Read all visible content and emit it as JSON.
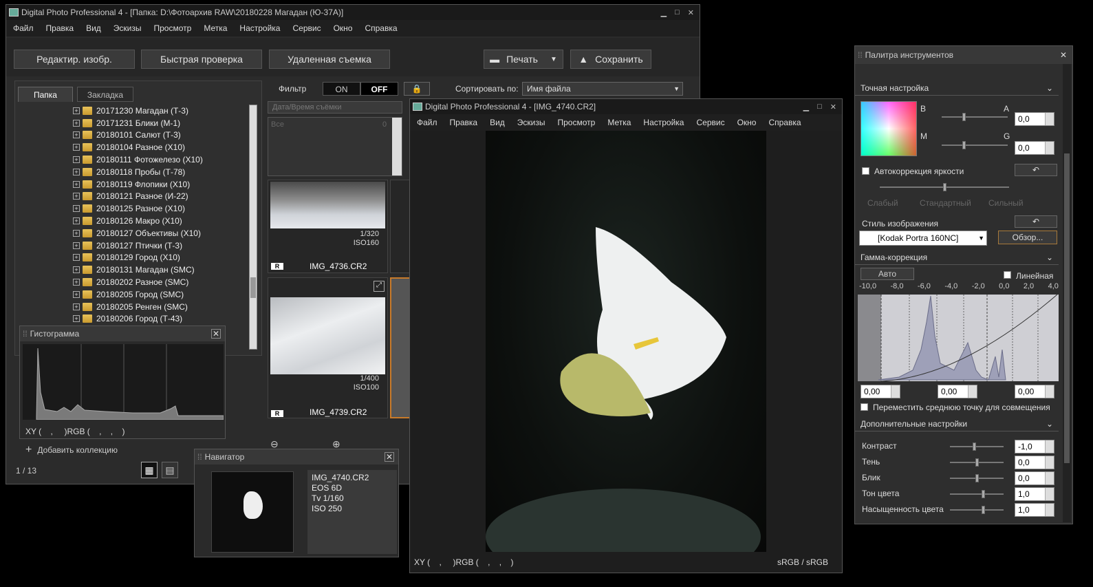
{
  "main": {
    "title": "Digital Photo Professional 4 - [Папка: D:\\Фотоархив RAW\\20180228 Магадан (Ю-37А)]",
    "menu": [
      "Файл",
      "Правка",
      "Вид",
      "Эскизы",
      "Просмотр",
      "Метка",
      "Настройка",
      "Сервис",
      "Окно",
      "Справка"
    ],
    "edit_btn": "Редактир. изобр.",
    "quick_btn": "Быстрая проверка",
    "remote_btn": "Удаленная съемка",
    "print_btn": "Печать",
    "save_btn": "Сохранить",
    "tab_folder": "Папка",
    "tab_bookmark": "Закладка",
    "folders": [
      "20171230 Магадан (Т-3)",
      "20171231 Блики (М-1)",
      "20180101 Салют (Т-3)",
      "20180104 Разное (Х10)",
      "20180111 Фотожелезо (Х10)",
      "20180118 Пробы (Т-78)",
      "20180119 Флопики (Х10)",
      "20180121 Разное (И-22)",
      "20180125 Разное (Х10)",
      "20180126 Макро (Х10)",
      "20180127 Объективы (Х10)",
      "20180127 Птички (Т-3)",
      "20180129 Город (Х10)",
      "20180131 Магадан (SMC)",
      "20180202 Разное (SMC)",
      "20180205 Город (SMC)",
      "20180205 Ренген (SMC)",
      "20180206 Город (Т-43)"
    ],
    "filter_label": "Фильтр",
    "on": "ON",
    "off": "OFF",
    "sort_label": "Сортировать по:",
    "sort_value": "Имя файла",
    "date_field": "Дата/Время съёмки",
    "all_label": "Все",
    "all_count": "0",
    "thumbs": [
      {
        "name": "IMG_4736.CR2",
        "shutter": "1/320",
        "iso": "ISO160"
      },
      {
        "name": "IMG_4739.CR2",
        "shutter": "1/400",
        "iso": "ISO100"
      }
    ],
    "raw_badge": "R",
    "add_collection": "Добавить коллекцию",
    "page_count": "1 / 13"
  },
  "histogram": {
    "title": "Гистограмма",
    "readout": "XY (    ,     )RGB (    ,    ,    )"
  },
  "navigator": {
    "title": "Навигатор",
    "file": "IMG_4740.CR2",
    "camera": "EOS 6D",
    "tv": "Tv 1/160",
    "iso": "ISO 250"
  },
  "viewer": {
    "title": "Digital Photo Professional 4 - [IMG_4740.CR2]",
    "readout": "XY (    ,     )RGB (    ,    ,    )",
    "profile": "sRGB / sRGB"
  },
  "palette": {
    "title": "Палитра инструментов",
    "fine": "Точная настройка",
    "b": "B",
    "a": "A",
    "m": "M",
    "g": "G",
    "val1": "0,0",
    "val2": "0,0",
    "autobright": "Автокоррекция яркости",
    "weak": "Слабый",
    "std": "Стандартный",
    "strong": "Сильный",
    "style_label": "Стиль изображения",
    "style_value": "[Kodak Portra 160NC]",
    "browse": "Обзор...",
    "gamma": "Гамма-коррекция",
    "auto": "Авто",
    "linear": "Линейная",
    "scale": [
      "-10,0",
      "-8,0",
      "-6,0",
      "-4,0",
      "-2,0",
      "0,0",
      "2,0",
      "4,0"
    ],
    "g1": "0,00",
    "g2": "0,00",
    "g3": "0,00",
    "midpoint": "Переместить среднюю точку для совмещения",
    "extra": "Дополнительные настройки",
    "adj": [
      {
        "label": "Контраст",
        "value": "-1,0",
        "level": 0.45
      },
      {
        "label": "Тень",
        "value": "0,0",
        "level": 0.5
      },
      {
        "label": "Блик",
        "value": "0,0",
        "level": 0.5
      },
      {
        "label": "Тон цвета",
        "value": "1,0",
        "level": 0.62
      },
      {
        "label": "Насыщенность цвета",
        "value": "1,0",
        "level": 0.62
      }
    ]
  }
}
